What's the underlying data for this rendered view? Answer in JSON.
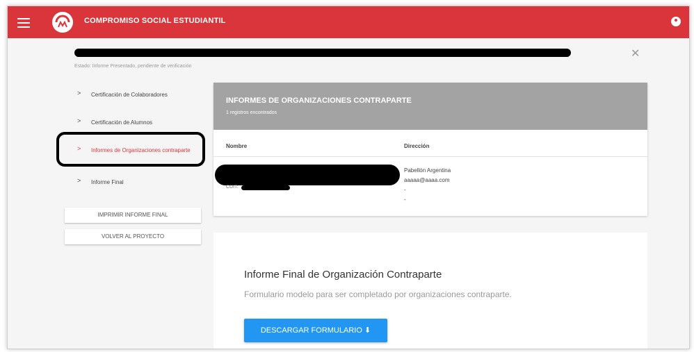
{
  "header": {
    "title": "COMPROMISO SOCIAL ESTUDIANTIL"
  },
  "project": {
    "estado": "Estado: Informe Presentado, pendiente de verificación"
  },
  "sidebar": {
    "items": [
      {
        "label": "Certificación de Colaboradores",
        "active": false
      },
      {
        "label": "Certificación de Alumnos",
        "active": false
      },
      {
        "label": "Informes de Organizaciones contraparte",
        "active": true
      },
      {
        "label": "Informe Final",
        "active": false
      }
    ],
    "print_button": "IMPRIMIR INFORME FINAL",
    "back_button": "VOLVER AL PROYECTO"
  },
  "informes": {
    "title": "INFORMES DE ORGANIZACIONES CONTRAPARTE",
    "count": "1 registros encontrados",
    "columns": [
      "Nombre",
      "Dirección"
    ],
    "row": {
      "cuit_label": "CUIT:",
      "direccion": [
        "Pabellón Argentina",
        "aaaaa@aaaa.com",
        "-",
        "-"
      ]
    }
  },
  "formulario": {
    "title": "Informe Final de Organización Contraparte",
    "subtitle": "Formulario modelo para ser completado por organizaciones contraparte.",
    "download_button": "DESCARGAR FORMULARIO ⬇"
  },
  "colors": {
    "primary": "#d9353a",
    "accent": "#2196f3",
    "header_gray": "#a3a3a3"
  }
}
